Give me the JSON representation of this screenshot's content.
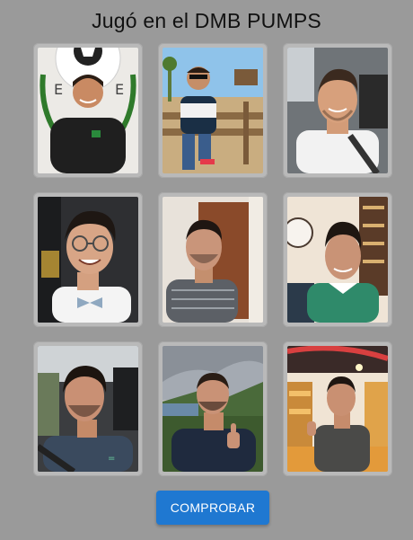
{
  "title": "Jugó en el DMB PUMPS",
  "submit_button": {
    "label": "COMPROBAR",
    "color": "#1f78d1"
  },
  "photos": [
    {
      "name": "photo-1",
      "subject": "man in black polo in front of football crest",
      "icon": "person-photo"
    },
    {
      "name": "photo-2",
      "subject": "man with sunglasses sitting on wooden fence",
      "icon": "person-photo"
    },
    {
      "name": "photo-3",
      "subject": "man smiling in car wearing seatbelt",
      "icon": "person-photo"
    },
    {
      "name": "photo-4",
      "subject": "man with glasses and bow tie in car",
      "icon": "person-photo"
    },
    {
      "name": "photo-5",
      "subject": "man in striped shirt indoors",
      "icon": "person-photo"
    },
    {
      "name": "photo-6",
      "subject": "man in green sweater smiling downward",
      "icon": "person-photo"
    },
    {
      "name": "photo-7",
      "subject": "man selfie in car",
      "icon": "person-photo"
    },
    {
      "name": "photo-8",
      "subject": "man giving thumbs up on mountain",
      "icon": "person-photo"
    },
    {
      "name": "photo-9",
      "subject": "man in store giving thumbs up",
      "icon": "person-photo"
    }
  ]
}
